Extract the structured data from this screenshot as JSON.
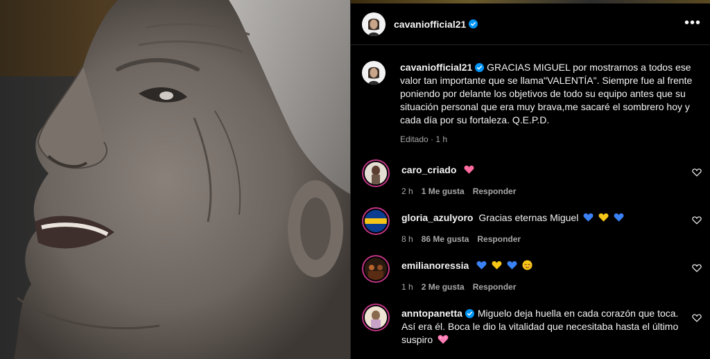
{
  "post": {
    "author": "cavaniofficial21",
    "caption_text": "GRACIAS MIGUEL por mostrarnos a todos ese valor tan importante que se llama\"VALENTÍA\". Siempre fue al frente poniendo por delante los objetivos de todo su equipo antes que su situación personal que era muy brava,me sacaré el sombrero hoy y cada día por su fortaleza. Q.E.P.D.",
    "edited_label": "Editado",
    "time": "1 h"
  },
  "comments": [
    {
      "username": "caro_criado",
      "text": "",
      "emojis": [
        "pink-heart"
      ],
      "time": "2 h",
      "likes": "1 Me gusta",
      "reply": "Responder",
      "verified": false
    },
    {
      "username": "gloria_azulyoro",
      "text": "Gracias eternas Miguel",
      "emojis": [
        "blue-heart",
        "yellow-heart",
        "blue-heart"
      ],
      "time": "8 h",
      "likes": "86 Me gusta",
      "reply": "Responder",
      "verified": false
    },
    {
      "username": "emilianoressia",
      "text": "",
      "emojis": [
        "blue-heart",
        "yellow-heart",
        "blue-heart",
        "relieved-face"
      ],
      "time": "1 h",
      "likes": "2 Me gusta",
      "reply": "Responder",
      "verified": false
    },
    {
      "username": "anntopanetta",
      "text": "Miguelo deja huella en cada corazón que toca. Así era él. Boca le dio la vitalidad que necesitaba hasta el último suspiro",
      "emojis": [
        "sparkling-heart"
      ],
      "time": "",
      "likes": "",
      "reply": "",
      "verified": true
    }
  ],
  "colors": {
    "verified": "#0095f6",
    "muted": "#a8a8a8",
    "pink_heart": "#ff6b9e",
    "blue_heart": "#3b82f6",
    "yellow_heart": "#f5c518"
  }
}
